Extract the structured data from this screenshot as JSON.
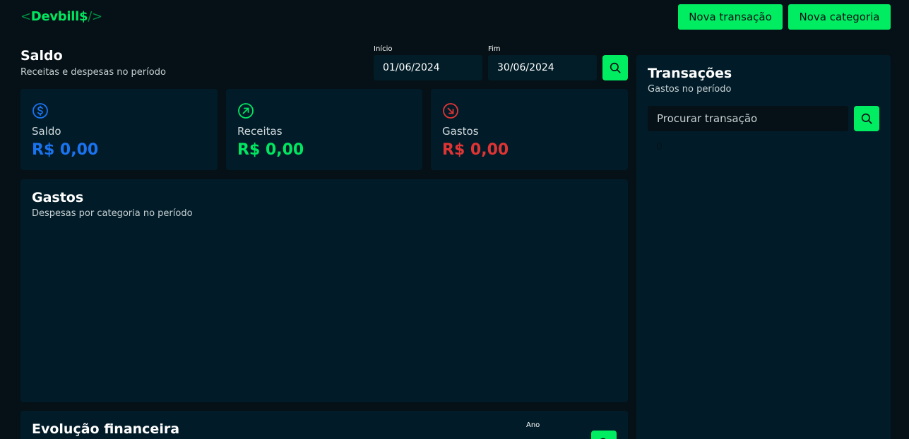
{
  "header": {
    "logo": {
      "open": "<",
      "name": "Devbill$",
      "close": "/>"
    },
    "new_transaction_label": "Nova transação",
    "new_category_label": "Nova categoria"
  },
  "balance_section": {
    "title": "Saldo",
    "subtitle": "Receitas e despesas no período",
    "start_label": "Início",
    "start_value": "01/06/2024",
    "end_label": "Fim",
    "end_value": "30/06/2024"
  },
  "cards": [
    {
      "label": "Saldo",
      "value": "R$ 0,00",
      "icon": "dollar-circle-icon",
      "color": "#1a73f0"
    },
    {
      "label": "Receitas",
      "value": "R$ 0,00",
      "icon": "arrow-up-right-circle-icon",
      "color": "#00e660"
    },
    {
      "label": "Gastos",
      "value": "R$ 0,00",
      "icon": "arrow-down-right-circle-icon",
      "color": "#e03434"
    }
  ],
  "expenses_panel": {
    "title": "Gastos",
    "subtitle": "Despesas por categoria no período"
  },
  "evolution_panel": {
    "title": "Evolução financeira",
    "year_label": "Ano"
  },
  "transactions_panel": {
    "title": "Transações",
    "subtitle": "Gastos no período",
    "search_placeholder": "Procurar transação",
    "count": "0"
  },
  "colors": {
    "background": "#051116",
    "card": "#011c28",
    "accent": "#00ed62"
  }
}
